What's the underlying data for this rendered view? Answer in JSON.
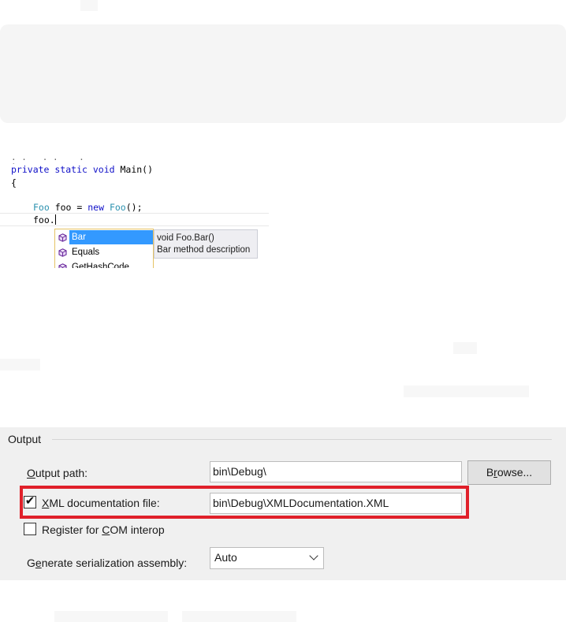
{
  "code": {
    "lines": [
      {
        "kw": "private static void",
        "rest": " Main()"
      },
      {
        "text": "{"
      },
      {
        "type": "Foo",
        "mid": " foo = ",
        "kw2": "new",
        "type2": " Foo",
        "end": "();"
      },
      {
        "text": "foo."
      }
    ],
    "intellisense": {
      "items": [
        "Bar",
        "Equals",
        "GetHashCode"
      ],
      "selected_index": 0,
      "tooltip": {
        "signature": "void Foo.Bar()",
        "description": "Bar method description"
      }
    }
  },
  "output_group": {
    "title": "Output",
    "output_path": {
      "label_prefix": "",
      "label_accel": "O",
      "label_rest": "utput path:",
      "value": "bin\\Debug\\"
    },
    "browse_button": {
      "pre": "B",
      "accel": "r",
      "post": "owse..."
    },
    "xml_doc": {
      "checked": true,
      "label_accel": "X",
      "label_rest": "ML documentation file:",
      "value": "bin\\Debug\\XMLDocumentation.XML"
    },
    "com_interop": {
      "checked": false,
      "label_pre": "Register for ",
      "label_accel": "C",
      "label_rest": "OM interop"
    },
    "serialization": {
      "label_pre": "G",
      "label_accel": "e",
      "label_rest": "nerate serialization assembly:",
      "value": "Auto"
    }
  },
  "colors": {
    "highlight": "#e0202a",
    "selection": "#3399ff",
    "keyword": "#1010c8",
    "type": "#2b91af"
  }
}
